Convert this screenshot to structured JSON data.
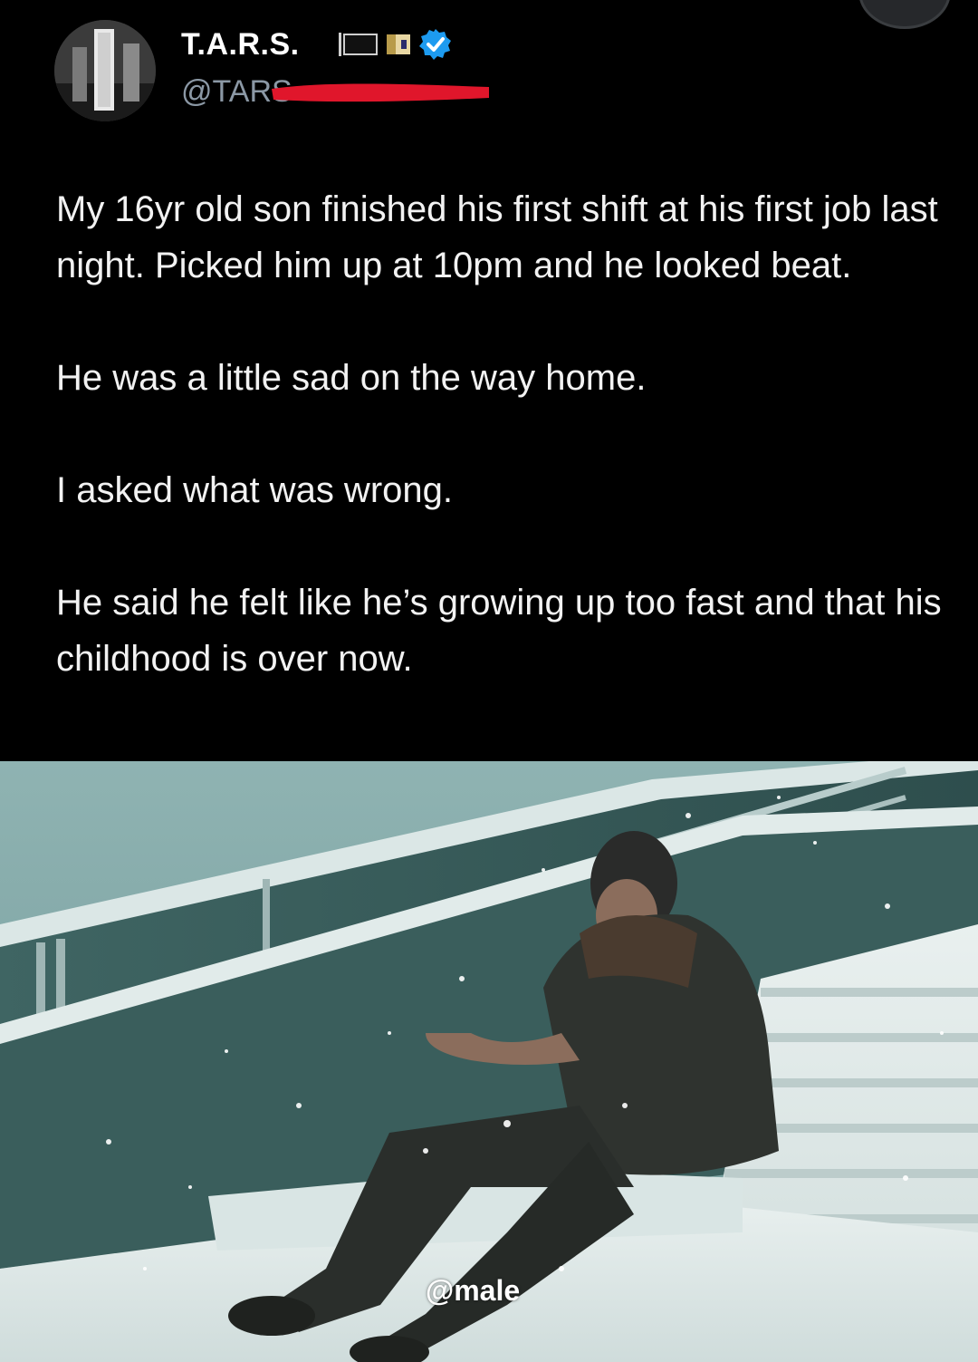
{
  "post": {
    "display_name": "T.A.R.S.",
    "handle": "@TARS",
    "paragraphs": [
      "My 16yr old son finished his first shift at his first job last night.  Picked him up at 10pm and he looked beat.",
      "He was a little sad on the way home.",
      "I asked what was wrong.",
      "He said he felt like he’s growing up too fast and that his childhood is over now."
    ]
  },
  "media": {
    "watermark": "@male"
  },
  "colors": {
    "background": "#000000",
    "text": "#f2f2f2",
    "handle": "#8b98a5",
    "verified": "#1d9bf0",
    "redaction": "#e0162b"
  },
  "icons": [
    "black-flag-icon",
    "flag-icon",
    "verified-badge-icon"
  ]
}
